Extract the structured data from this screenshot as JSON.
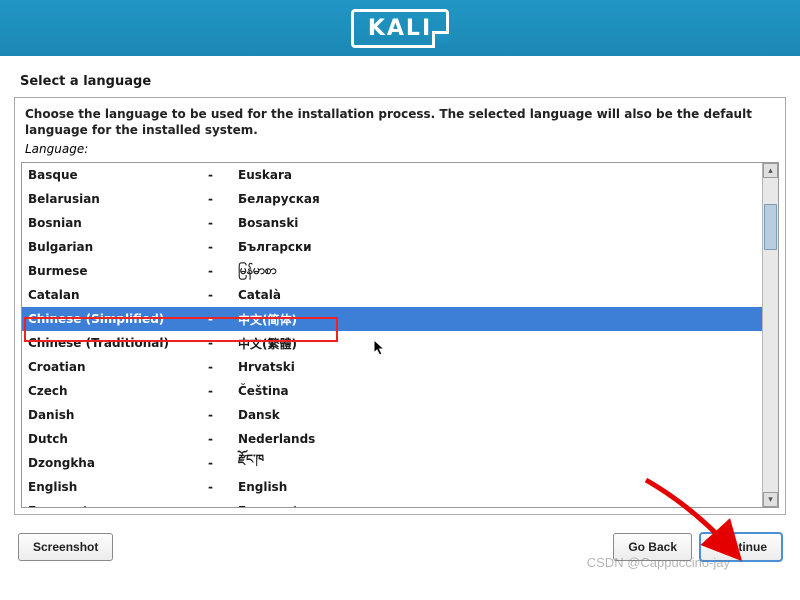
{
  "header": {
    "logo_text": "KALI"
  },
  "title": "Select a language",
  "instruction": "Choose the language to be used for the installation process. The selected language will also be the default language for the installed system.",
  "field_label": "Language:",
  "languages": [
    {
      "english": "Basque",
      "native": "Euskara",
      "selected": false
    },
    {
      "english": "Belarusian",
      "native": "Беларуская",
      "selected": false
    },
    {
      "english": "Bosnian",
      "native": "Bosanski",
      "selected": false
    },
    {
      "english": "Bulgarian",
      "native": "Български",
      "selected": false
    },
    {
      "english": "Burmese",
      "native": "မြန်မာစာ",
      "selected": false
    },
    {
      "english": "Catalan",
      "native": "Català",
      "selected": false
    },
    {
      "english": "Chinese (Simplified)",
      "native": "中文(简体)",
      "selected": true
    },
    {
      "english": "Chinese (Traditional)",
      "native": "中文(繁體)",
      "selected": false
    },
    {
      "english": "Croatian",
      "native": "Hrvatski",
      "selected": false
    },
    {
      "english": "Czech",
      "native": "Čeština",
      "selected": false
    },
    {
      "english": "Danish",
      "native": "Dansk",
      "selected": false
    },
    {
      "english": "Dutch",
      "native": "Nederlands",
      "selected": false
    },
    {
      "english": "Dzongkha",
      "native": "རྫོང་ཁ",
      "selected": false
    },
    {
      "english": "English",
      "native": "English",
      "selected": false
    },
    {
      "english": "Esperanto",
      "native": "Esperanto",
      "selected": false
    }
  ],
  "separator": "-",
  "buttons": {
    "screenshot": "Screenshot",
    "go_back": "Go Back",
    "continue": "Continue"
  },
  "watermark": "CSDN @Cappuccino-jay"
}
